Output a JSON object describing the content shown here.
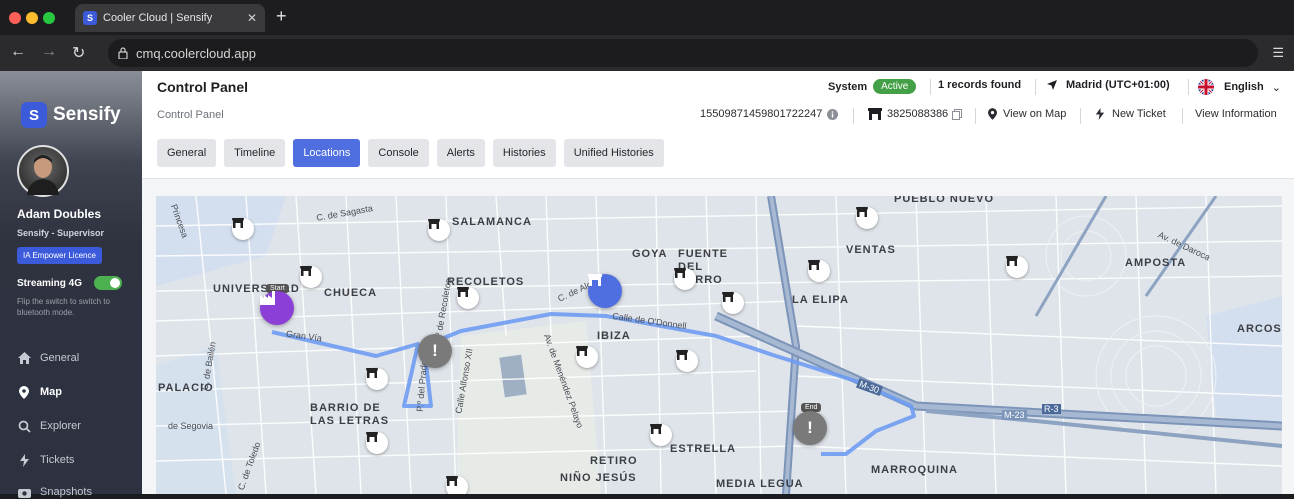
{
  "browser": {
    "tab_title": "Cooler Cloud | Sensify",
    "url": "cmq.coolercloud.app",
    "tab_close": "✕",
    "new_tab": "+"
  },
  "sidebar": {
    "brand": "Sensify",
    "user_name": "Adam Doubles",
    "user_role": "Sensify - Supervisor",
    "licence": "IA Empower Licence",
    "streaming_label": "Streaming 4G",
    "streaming_on": true,
    "streaming_hint": "Flip the switch to switch to bluetooth mode.",
    "items": [
      {
        "label": "General",
        "icon": "home-icon"
      },
      {
        "label": "Map",
        "icon": "map-pin-icon"
      },
      {
        "label": "Explorer",
        "icon": "search-icon"
      },
      {
        "label": "Tickets",
        "icon": "ticket-icon"
      },
      {
        "label": "Snapshots",
        "icon": "camera-icon"
      }
    ]
  },
  "header": {
    "title": "Control Panel",
    "breadcrumb": "Control Panel",
    "system_label": "System",
    "system_status": "Active",
    "records": "1 records found",
    "location": "Madrid (UTC+01:00)",
    "language": "English",
    "device_id": "1550987145980172224​7",
    "asset_id": "3825088386",
    "view_on_map": "View on Map",
    "new_ticket": "New Ticket",
    "view_information": "View Information"
  },
  "tabs": [
    "General",
    "Timeline",
    "Locations",
    "Console",
    "Alerts",
    "Histories",
    "Unified Histories"
  ],
  "active_tab": "Locations",
  "map": {
    "districts": [
      "UNIVERSIDAD",
      "CHUECA",
      "SALAMANCA",
      "RECOLETOS",
      "GOYA",
      "FUENTE DEL BERRO",
      "VENTAS",
      "PUEBLO NUEVO",
      "AMPOSTA",
      "LA ELIPA",
      "IBIZA",
      "ARCOS",
      "PALACIO",
      "BARRIO DE LAS LETRAS",
      "RETIRO",
      "ESTRELLA",
      "NIÑO JESÚS",
      "MEDIA LEGUA",
      "MARROQUINA"
    ],
    "streets": [
      "C. de Sagasta",
      "C. de Alcalá",
      "Calle de O'Donnell",
      "Gran Vía",
      "Av. de Daroca",
      "C. de Bailén",
      "P.º del Prado",
      "Calle Alfonso XII",
      "Av. de Menéndez Pelayo",
      "C. de Toledo",
      "de Segovia",
      "Princesa",
      "P.º de Recoletos",
      "M-23",
      "R-3",
      "M-30"
    ],
    "start_label": "Start",
    "end_label": "End"
  },
  "colors": {
    "accent": "#4f6fe0",
    "active_badge": "#43a047",
    "route": "#6f9cf2",
    "start_pin": "#8b3fd6",
    "end_pin": "#7a7a7a"
  }
}
